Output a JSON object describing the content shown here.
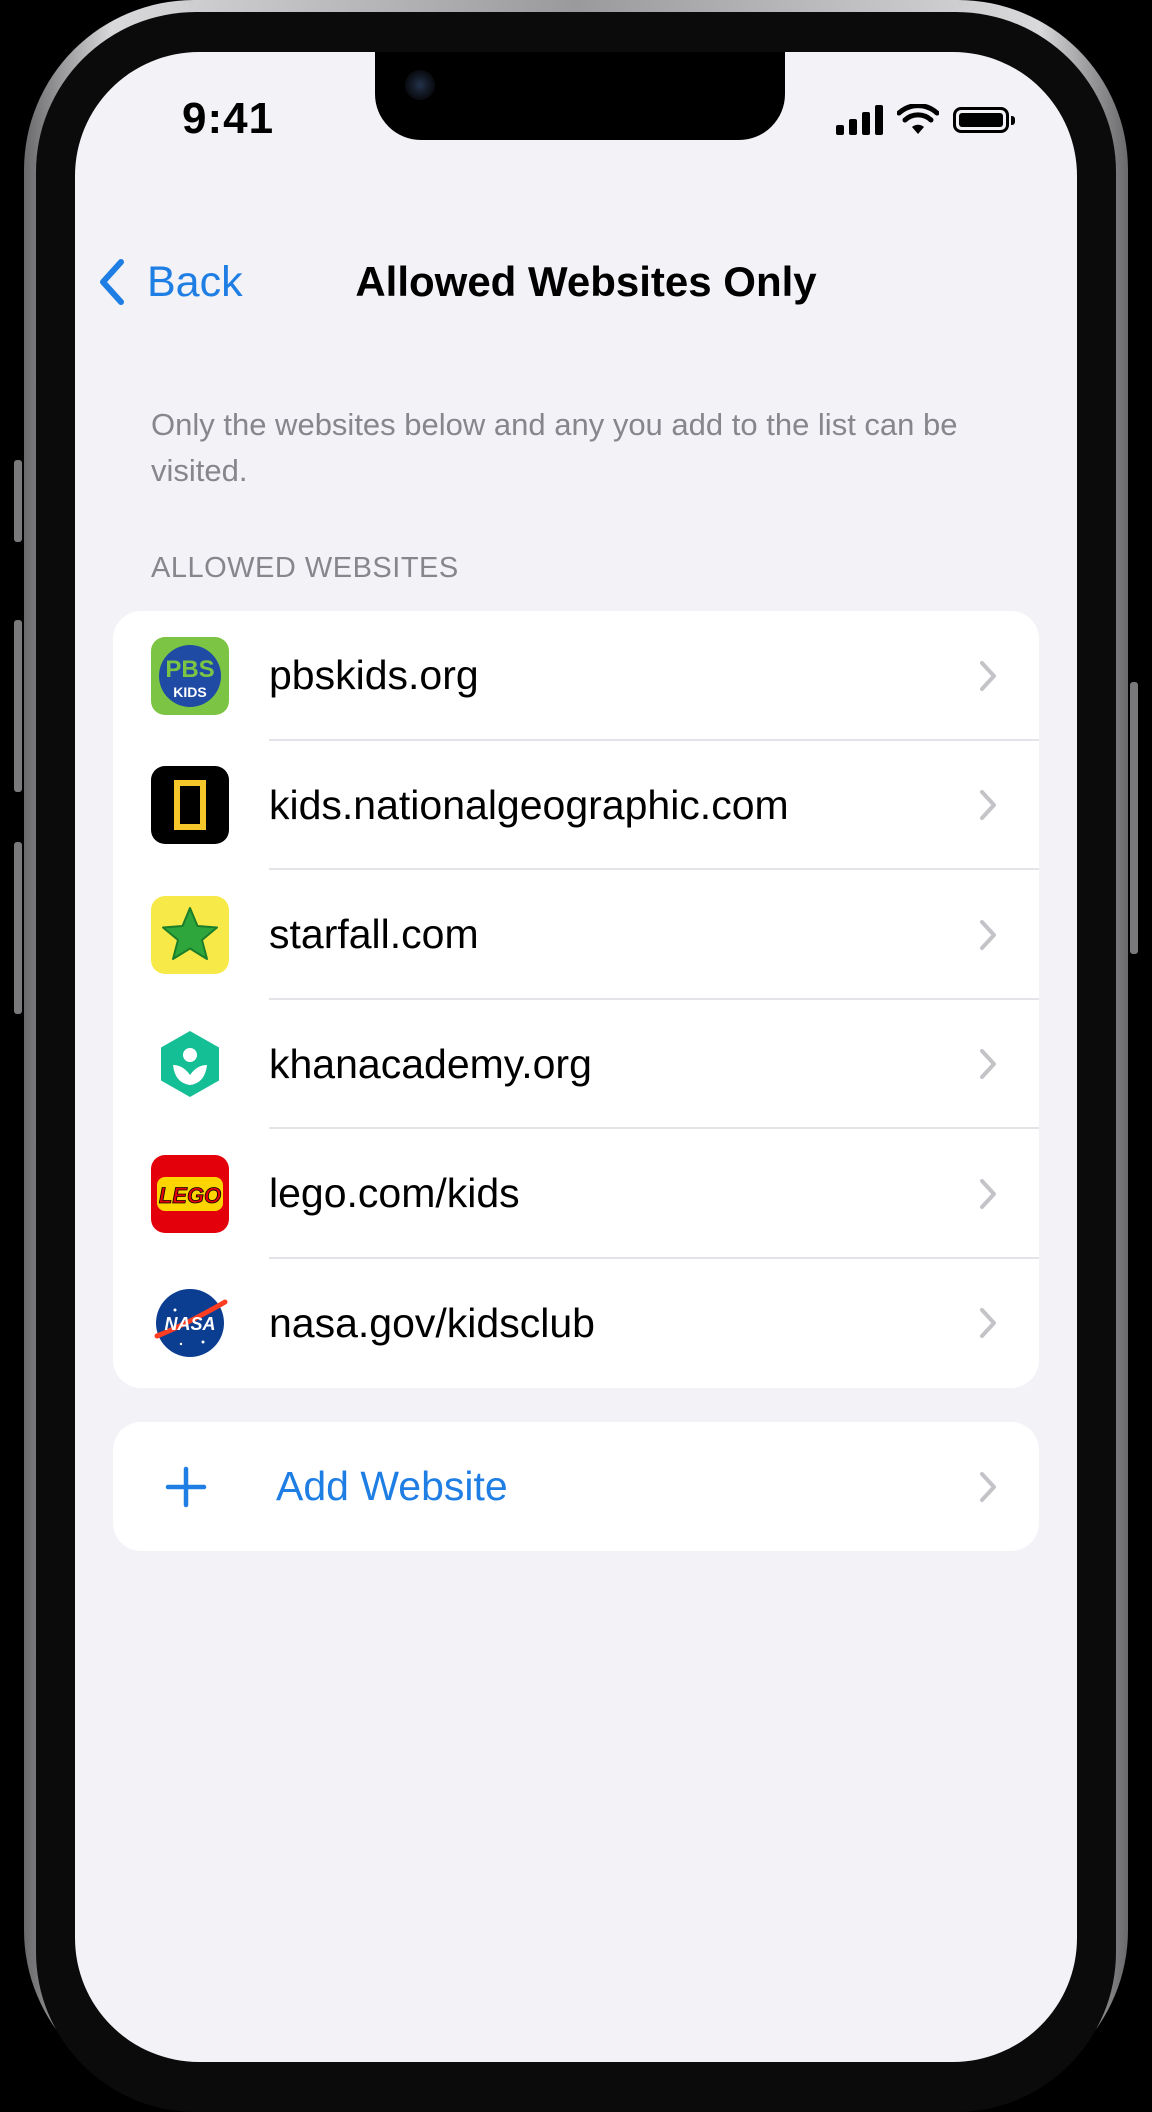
{
  "status": {
    "time": "9:41"
  },
  "nav": {
    "back_label": "Back",
    "title": "Allowed Websites Only"
  },
  "description": "Only the websites below and any you add to the list can be visited.",
  "section_header": "ALLOWED WEBSITES",
  "sites": [
    {
      "label": "pbskids.org",
      "icon": "pbs-kids-icon"
    },
    {
      "label": "kids.nationalgeographic.com",
      "icon": "national-geographic-icon"
    },
    {
      "label": "starfall.com",
      "icon": "starfall-star-icon"
    },
    {
      "label": "khanacademy.org",
      "icon": "khan-academy-icon"
    },
    {
      "label": "lego.com/kids",
      "icon": "lego-icon"
    },
    {
      "label": "nasa.gov/kidsclub",
      "icon": "nasa-icon"
    }
  ],
  "icon_text": {
    "pbs_top": "PBS",
    "pbs_bottom": "KIDS",
    "lego": "LEGO",
    "nasa": "NASA"
  },
  "add": {
    "label": "Add Website"
  },
  "colors": {
    "accent": "#1e7ee4",
    "background": "#f2f2f7",
    "secondary_text": "#86868c",
    "chevron": "#c4c4c8"
  }
}
